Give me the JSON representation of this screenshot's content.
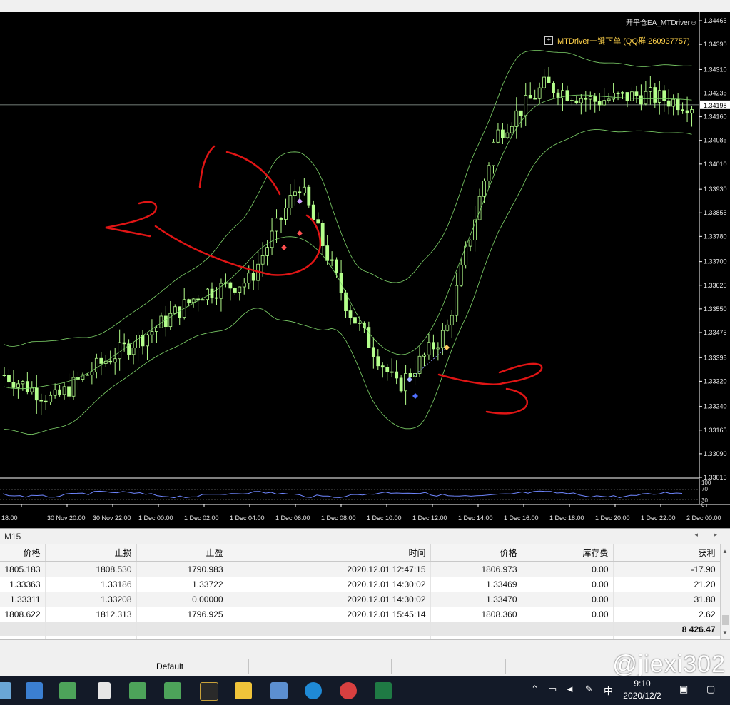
{
  "chart": {
    "ea_title": "开平仓EA_MTDriver☺",
    "panel_text": "MTDriver一键下单 (QQ群:260937757)",
    "current_price": "1.34198",
    "price_scale": [
      "1.34465",
      "1.34390",
      "1.34310",
      "1.34235",
      "1.34160",
      "1.34085",
      "1.34010",
      "1.33930",
      "1.33855",
      "1.33780",
      "1.33700",
      "1.33625",
      "1.33550",
      "1.33475",
      "1.33395",
      "1.33320",
      "1.33240",
      "1.33165",
      "1.33090",
      "1.33015"
    ],
    "oscillator_scale": [
      "100",
      "70",
      "30",
      "0"
    ],
    "time_scale": [
      "18:00",
      "30 Nov 20:00",
      "30 Nov 22:00",
      "1 Dec 00:00",
      "1 Dec 02:00",
      "1 Dec 04:00",
      "1 Dec 06:00",
      "1 Dec 08:00",
      "1 Dec 10:00",
      "1 Dec 12:00",
      "1 Dec 14:00",
      "1 Dec 16:00",
      "1 Dec 18:00",
      "1 Dec 20:00",
      "1 Dec 22:00",
      "2 Dec 00:00"
    ],
    "colors": {
      "background": "#000000",
      "candle": "#b4ff8c",
      "bands": "#7fd46a",
      "annotation": "#e01515",
      "oscillator": "#6f86ff"
    }
  },
  "chart_data": {
    "type": "candlestick",
    "title": "",
    "xlabel": "",
    "ylabel": "",
    "ylim": [
      1.33015,
      1.34465
    ],
    "x": [
      "30 Nov 20:00",
      "30 Nov 22:00",
      "1 Dec 00:00",
      "1 Dec 02:00",
      "1 Dec 04:00",
      "1 Dec 06:00",
      "1 Dec 08:00",
      "1 Dec 10:00",
      "1 Dec 12:00",
      "1 Dec 14:00",
      "1 Dec 16:00",
      "1 Dec 18:00",
      "1 Dec 20:00",
      "1 Dec 22:00",
      "2 Dec 00:00"
    ],
    "close_approx": [
      1.3334,
      1.3326,
      1.3338,
      1.3348,
      1.336,
      1.3364,
      1.3395,
      1.3355,
      1.333,
      1.3348,
      1.341,
      1.3426,
      1.3421,
      1.3423,
      1.34198
    ]
  },
  "tabs": {
    "timeframe_tab": "M15",
    "scroll_arrows": "◂ ▸"
  },
  "orders": {
    "headers": [
      "价格",
      "止损",
      "止盈",
      "时间",
      "价格",
      "库存费",
      "获利"
    ],
    "rows": [
      [
        "1805.183",
        "1808.530",
        "1790.983",
        "2020.12.01 12:47:15",
        "1806.973",
        "0.00",
        "-17.90"
      ],
      [
        "1.33363",
        "1.33186",
        "1.33722",
        "2020.12.01 14:30:02",
        "1.33469",
        "0.00",
        "21.20"
      ],
      [
        "1.33311",
        "1.33208",
        "0.00000",
        "2020.12.01 14:30:02",
        "1.33470",
        "0.00",
        "31.80"
      ],
      [
        "1808.622",
        "1812.313",
        "1796.925",
        "2020.12.01 15:45:14",
        "1808.360",
        "0.00",
        "2.62"
      ]
    ],
    "total": "8 426.47"
  },
  "status": {
    "profile": "Default"
  },
  "watermark": "@jiexi302",
  "taskbar": {
    "icons": [
      "app-icon",
      "window-icon",
      "user-app-icon",
      "file-icon",
      "user-app-icon",
      "user-app-icon",
      "mt-terminal-icon",
      "folder-icon",
      "calculator-icon",
      "edge-icon",
      "scissors-icon",
      "excel-icon"
    ],
    "tray": {
      "ime": "中",
      "time": "9:10",
      "date": "2020/12/2"
    }
  }
}
